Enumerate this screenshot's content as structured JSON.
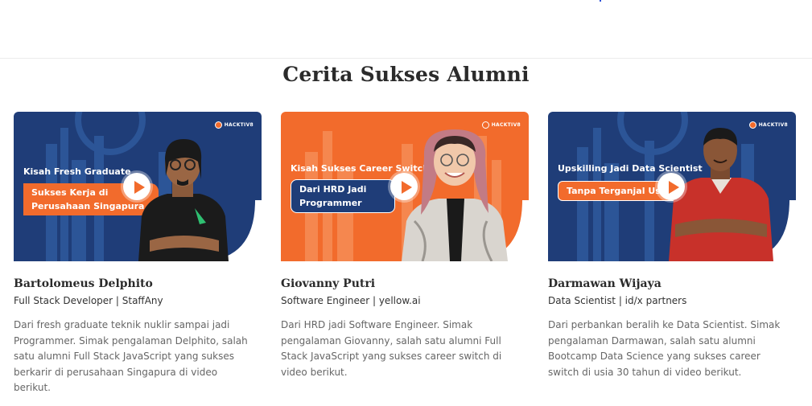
{
  "section": {
    "title": "Cerita Sukses Alumni"
  },
  "brand": {
    "name": "HACKTIV8"
  },
  "alumni": [
    {
      "headline": "Kisah Fresh Graduate",
      "pill": "Sukses Kerja di Perusahaan Singapura",
      "name": "Bartolomeus Delphito",
      "role": "Full Stack Developer | StaffAny",
      "description": "Dari fresh graduate teknik nuklir sampai jadi Programmer. Simak pengalaman Delphito, salah satu alumni Full Stack JavaScript yang sukses berkarir di perusahaan Singapura di video berikut."
    },
    {
      "headline": "Kisah Sukses Career Switch",
      "pill": "Dari HRD Jadi Programmer",
      "name": "Giovanny Putri",
      "role": "Software Engineer | yellow.ai",
      "description": "Dari HRD jadi Software Engineer. Simak pengalaman Giovanny, salah satu alumni Full Stack JavaScript yang sukses career switch di video berikut."
    },
    {
      "headline": "Upskilling Jadi Data Scientist",
      "pill": "Tanpa Terganjal Usia",
      "name": "Darmawan Wijaya",
      "role": "Data Scientist | id/x partners",
      "description": "Dari perbankan beralih ke Data Scientist. Simak pengalaman Darmawan, salah satu alumni Bootcamp Data Science yang sukses career switch di usia 30 tahun di video berikut."
    }
  ],
  "colors": {
    "navy": "#1f3d78",
    "orange": "#f26b2c",
    "skyline_blue": "#2c5597",
    "skyline_orange": "#f5874f"
  }
}
